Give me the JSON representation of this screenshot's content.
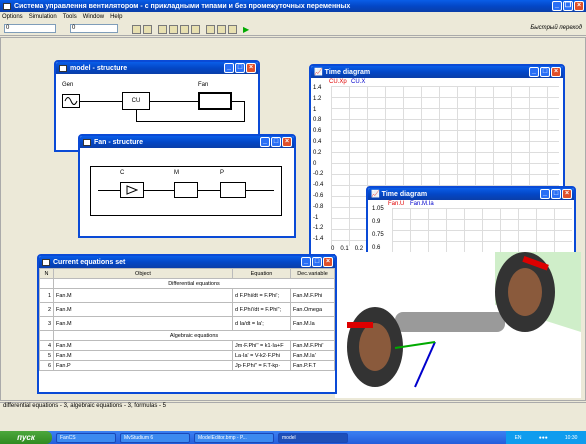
{
  "app": {
    "title": "Система управлення вентилятором - с прикладными типами и без промежуточных переменных",
    "menu": [
      "Options",
      "Simulation",
      "Tools",
      "Window",
      "Help"
    ],
    "field1": "0",
    "field2": "0",
    "quick_button": "Быстрый переход"
  },
  "model_window": {
    "title": "model - structure",
    "blocks": {
      "gen": "Gen",
      "cu": "CU",
      "fan": "Fan"
    }
  },
  "fan_window": {
    "title": "Fan - structure",
    "blocks": {
      "c": "C",
      "m": "M",
      "p": "P"
    }
  },
  "time1": {
    "title": "Time diagram",
    "legend": [
      "CU.Xp",
      "CU.X"
    ],
    "yticks": [
      "1.4",
      "1.2",
      "1",
      "0.8",
      "0.6",
      "0.4",
      "0.2",
      "0",
      "-0.2",
      "-0.4",
      "-0.6",
      "-0.8",
      "-1",
      "-1.2",
      "-1.4"
    ],
    "xticks": [
      "0",
      "0.1",
      "0.2"
    ]
  },
  "time2": {
    "title": "Time diagram",
    "legend": [
      "Fan.U",
      "Fan.M.Ia"
    ],
    "yticks": [
      "1.05",
      "0.9",
      "0.75",
      "0.6"
    ]
  },
  "equations": {
    "title": "Current equations set",
    "headers": [
      "N",
      "Object",
      "Equation",
      "Dec.variable"
    ],
    "sec_diff": "Differential equations",
    "sec_alg": "Algebraic equations",
    "rows": [
      {
        "n": "1",
        "obj": "Fan.M",
        "eq": "d F.Phi/dt = F.Phi';",
        "dv": "Fan.M.F.Phi"
      },
      {
        "n": "2",
        "obj": "Fan.M",
        "eq": "d F.Phi'/dt = F.Phi'';",
        "dv": "Fan.Omega"
      },
      {
        "n": "3",
        "obj": "Fan.M",
        "eq": "d Ia/dt = Ia';",
        "dv": "Fan.M.Ia"
      },
      {
        "n": "4",
        "obj": "Fan.M",
        "eq": "Jm·F.Phi'' = k1·Ia+F",
        "dv": "Fan.M.F.Phi'"
      },
      {
        "n": "5",
        "obj": "Fan.M",
        "eq": "La·Ia' = V-k2·F.Phi",
        "dv": "Fan.M.Ia'"
      },
      {
        "n": "6",
        "obj": "Fan.P",
        "eq": "Jp·F.Phi'' = F.T-kp·",
        "dv": "Fan.P.F.T"
      }
    ]
  },
  "status": "differential equations - 3, algebraic equations - 3, formulas - 5",
  "taskbar": {
    "start": "пуск",
    "tasks": [
      "FanCS",
      "MvStudium 6",
      "ModelEditor.bmp - P...",
      "model"
    ],
    "lang": "EN",
    "time": "10:30"
  },
  "colors": {
    "xp_blue": "#0a4ad6",
    "legend_red": "#e00000",
    "legend_blue": "#0000cc"
  }
}
